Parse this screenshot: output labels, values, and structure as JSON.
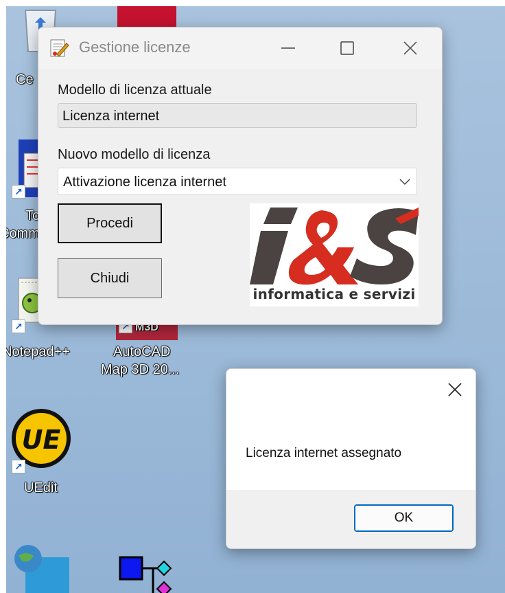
{
  "desktop": {
    "icons": [
      {
        "label": "Ce"
      },
      {
        "label": "To"
      },
      {
        "label": "Comm"
      },
      {
        "label": "Notepad++"
      },
      {
        "label": "AutoCAD"
      },
      {
        "label": "Map 3D 20..."
      },
      {
        "label": "UEdit"
      },
      {
        "badge": "M3D"
      }
    ]
  },
  "window": {
    "title": "Gestione licenze",
    "current_label": "Modello di licenza attuale",
    "current_value": "Licenza internet",
    "new_label": "Nuovo modello di licenza",
    "new_value": "Attivazione licenza internet",
    "proceed_button": "Procedi",
    "close_button": "Chiudi",
    "logo_tagline": "informatica e servizi",
    "logo_text": "i&S"
  },
  "message": {
    "text": "Licenza internet assegnato",
    "ok_button": "OK"
  },
  "colors": {
    "accent": "#0067c0",
    "logo_dark": "#4a4342",
    "logo_red": "#d62d20"
  }
}
